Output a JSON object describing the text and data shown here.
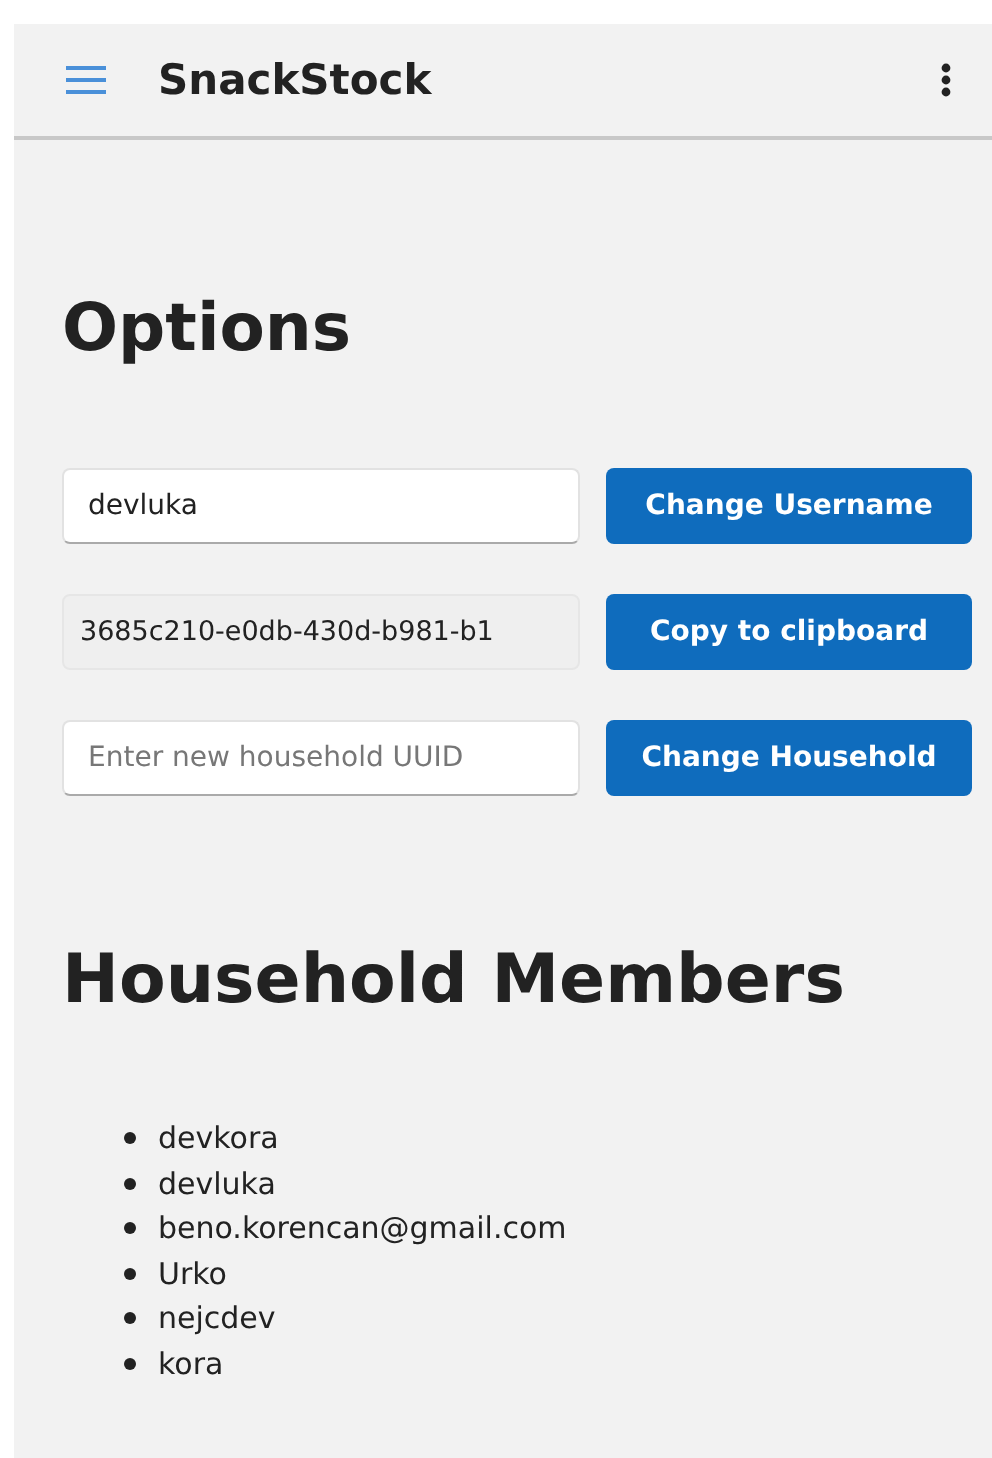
{
  "app_bar": {
    "title": "SnackStock"
  },
  "options": {
    "heading": "Options",
    "rows": [
      {
        "field": {
          "kind": "editable",
          "value": "devluka"
        },
        "button": "Change Username"
      },
      {
        "field": {
          "kind": "readonly",
          "value": "3685c210-e0db-430d-b981-b1"
        },
        "button": "Copy to clipboard"
      },
      {
        "field": {
          "kind": "editable",
          "placeholder": "Enter new household UUID"
        },
        "button": "Change Household"
      }
    ]
  },
  "members": {
    "heading": "Household Members",
    "items": [
      "devkora",
      "devluka",
      "beno.korencan@gmail.com",
      "Urko",
      "nejcdev",
      "kora"
    ]
  }
}
